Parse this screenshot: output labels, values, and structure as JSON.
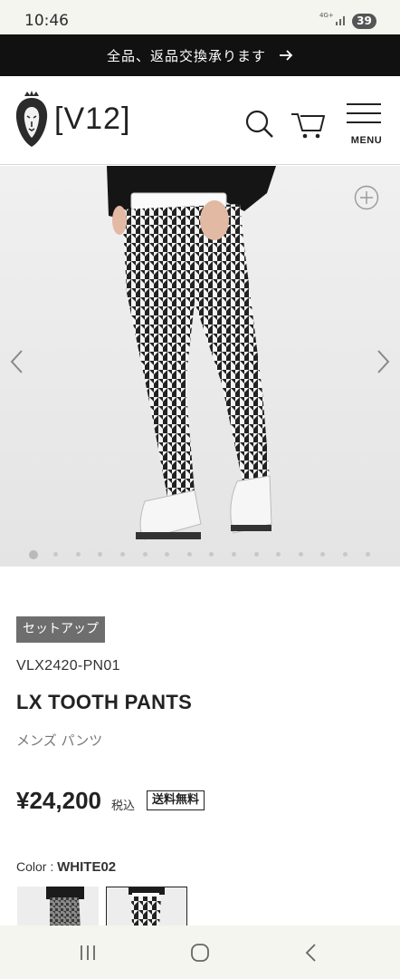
{
  "status_bar": {
    "time": "10:46",
    "network": "4G+",
    "battery": "39"
  },
  "promo": {
    "text": "全品、返品交換承ります",
    "arrow_icon": "arrow-right-icon"
  },
  "header": {
    "brand": "[V12]",
    "logo_icon": "lion-crown-icon",
    "search_icon": "search-icon",
    "cart_icon": "cart-icon",
    "menu_label": "MENU"
  },
  "gallery": {
    "zoom_icon": "plus-circle-icon",
    "prev_icon": "chevron-left-icon",
    "next_icon": "chevron-right-icon",
    "slide_count": 16,
    "active_slide": 1
  },
  "product": {
    "tag": "セットアップ",
    "sku": "VLX2420-PN01",
    "name": "LX TOOTH PANTS",
    "category": "メンズ パンツ",
    "price": "¥24,200",
    "tax_label": "税込",
    "shipping_badge": "送料無料",
    "color_label": "Color : ",
    "color_value": "WHITE02"
  },
  "colors": {
    "page_bg": "#ffffff",
    "banner_bg": "#111111",
    "tag_bg": "#6e6e6e",
    "gallery_bg": "#ececec",
    "system_bar_bg": "#f3f5ee"
  }
}
